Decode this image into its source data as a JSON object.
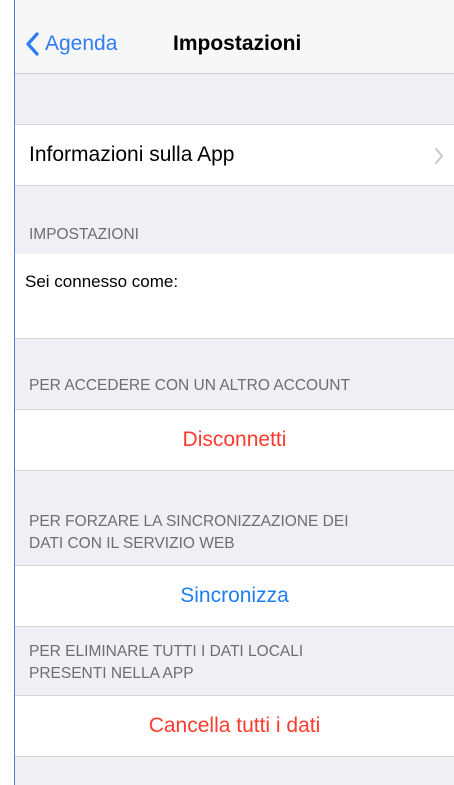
{
  "navbar": {
    "back_label": "Agenda",
    "title": "Impostazioni"
  },
  "app_info": {
    "label": "Informazioni sulla App"
  },
  "settings_section": {
    "header": "IMPOSTAZIONI",
    "connected_label": "Sei connesso come:"
  },
  "logout_section": {
    "header": "PER ACCEDERE CON UN ALTRO ACCOUNT",
    "button_label": "Disconnetti"
  },
  "sync_section": {
    "header_line1": "PER FORZARE LA SINCRONIZZAZIONE DEI",
    "header_line2": "DATI CON IL SERVIZIO WEB",
    "button_label": "Sincronizza"
  },
  "delete_section": {
    "header_line1": "PER ELIMINARE TUTTI I DATI LOCALI",
    "header_line2": "PRESENTI NELLA APP",
    "button_label": "Cancella tutti i dati"
  },
  "icons": {
    "back": "chevron-left-icon",
    "disclosure": "chevron-right-icon"
  },
  "colors": {
    "tint_blue": "#2f7cf6",
    "destructive_red": "#ff3b30",
    "grouped_background": "#efeff4",
    "section_header_gray": "#6d6d72"
  }
}
